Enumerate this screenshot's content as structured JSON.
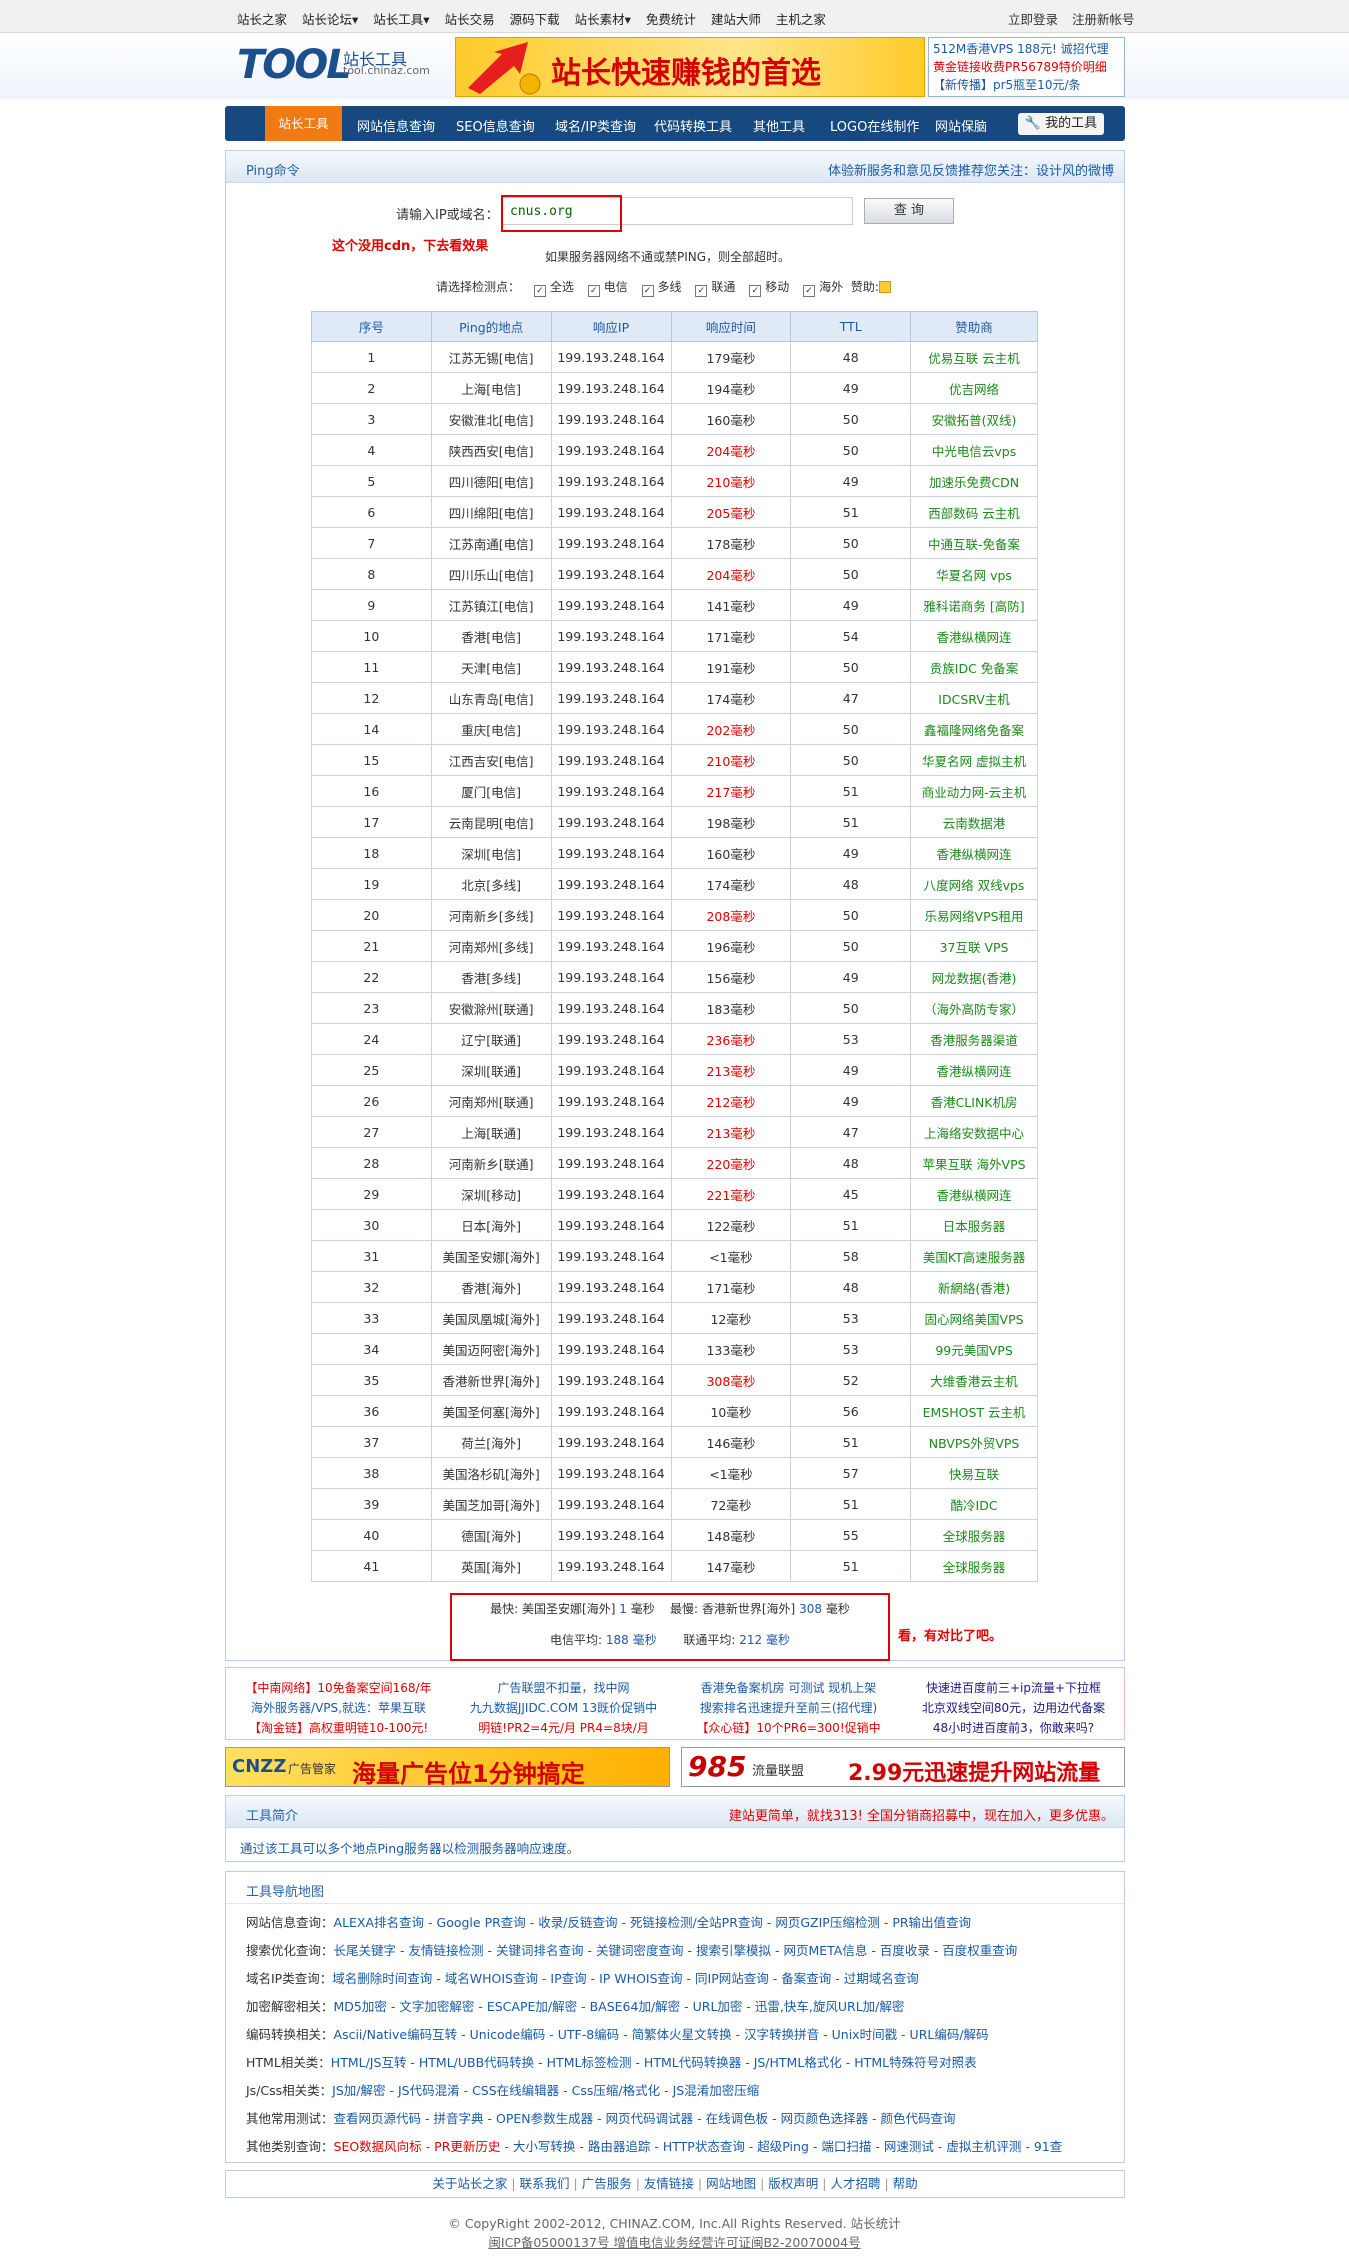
{
  "top_nav": [
    "站长之家",
    "站长论坛▾",
    "站长工具▾",
    "站长交易",
    "源码下载",
    "站长素材▾",
    "免费统计",
    "建站大师",
    "主机之家"
  ],
  "top_right": [
    "立即登录",
    "注册新帐号"
  ],
  "logo": {
    "main": "TOOL",
    "cn": "站长工具",
    "url": "tool.chinaz.com"
  },
  "banner_text": "站长快速赚钱的首选",
  "side_ads": [
    "512M香港VPS 188元! 诚招代理",
    "黄金链接收费PR56789特价明细",
    "【新传播】pr5瓶至10元/条"
  ],
  "menu": {
    "active": "站长工具",
    "items": [
      "网站信息查询",
      "SEO信息查询",
      "域名/IP类查询",
      "代码转换工具",
      "其他工具",
      "LOGO在线制作",
      "网站保脑"
    ],
    "mine": "我的工具"
  },
  "ping": {
    "title": "Ping命令",
    "notice": "体验新服务和意见反馈推荐您关注：设计风的微博",
    "input_label": "请输入IP或域名：",
    "input_value": "cnus.org",
    "query_btn": "查  询",
    "note": "这个没用cdn，下去看效果",
    "tip": "如果服务器网络不通或禁PING，则全部超时。",
    "checks_label": "请选择检测点：",
    "checks": [
      "全选",
      "电信",
      "多线",
      "联通",
      "移动",
      "海外"
    ],
    "sponsor_label": "赞助:"
  },
  "table": {
    "headers": [
      "序号",
      "Ping的地点",
      "响应IP",
      "响应时间",
      "TTL",
      "赞助商"
    ],
    "rows": [
      [
        "1",
        "江苏无锡[电信]",
        "199.193.248.164",
        "179毫秒",
        "48",
        "优易互联  云主机"
      ],
      [
        "2",
        "上海[电信]",
        "199.193.248.164",
        "194毫秒",
        "49",
        "优吉网络"
      ],
      [
        "3",
        "安徽淮北[电信]",
        "199.193.248.164",
        "160毫秒",
        "50",
        "安徽拓普(双线)"
      ],
      [
        "4",
        "陕西西安[电信]",
        "199.193.248.164",
        "204毫秒",
        "50",
        "中光电信云vps"
      ],
      [
        "5",
        "四川德阳[电信]",
        "199.193.248.164",
        "210毫秒",
        "49",
        "加速乐免费CDN"
      ],
      [
        "6",
        "四川绵阳[电信]",
        "199.193.248.164",
        "205毫秒",
        "51",
        "西部数码  云主机"
      ],
      [
        "7",
        "江苏南通[电信]",
        "199.193.248.164",
        "178毫秒",
        "50",
        "中通互联-免备案"
      ],
      [
        "8",
        "四川乐山[电信]",
        "199.193.248.164",
        "204毫秒",
        "50",
        "华夏名网  vps"
      ],
      [
        "9",
        "江苏镇江[电信]",
        "199.193.248.164",
        "141毫秒",
        "49",
        "雅科诺商务 [高防]"
      ],
      [
        "10",
        "香港[电信]",
        "199.193.248.164",
        "171毫秒",
        "54",
        "香港纵横网连"
      ],
      [
        "11",
        "天津[电信]",
        "199.193.248.164",
        "191毫秒",
        "50",
        "贵族IDC 免备案"
      ],
      [
        "12",
        "山东青岛[电信]",
        "199.193.248.164",
        "174毫秒",
        "47",
        "IDCSRV主机"
      ],
      [
        "14",
        "重庆[电信]",
        "199.193.248.164",
        "202毫秒",
        "50",
        "鑫福隆网络免备案"
      ],
      [
        "15",
        "江西吉安[电信]",
        "199.193.248.164",
        "210毫秒",
        "50",
        "华夏名网  虚拟主机"
      ],
      [
        "16",
        "厦门[电信]",
        "199.193.248.164",
        "217毫秒",
        "51",
        "商业动力网-云主机"
      ],
      [
        "17",
        "云南昆明[电信]",
        "199.193.248.164",
        "198毫秒",
        "51",
        "云南数据港"
      ],
      [
        "18",
        "深圳[电信]",
        "199.193.248.164",
        "160毫秒",
        "49",
        "香港纵横网连"
      ],
      [
        "19",
        "北京[多线]",
        "199.193.248.164",
        "174毫秒",
        "48",
        "八度网络 双线vps"
      ],
      [
        "20",
        "河南新乡[多线]",
        "199.193.248.164",
        "208毫秒",
        "50",
        "乐易网络VPS租用"
      ],
      [
        "21",
        "河南郑州[多线]",
        "199.193.248.164",
        "196毫秒",
        "50",
        "37互联  VPS"
      ],
      [
        "22",
        "香港[多线]",
        "199.193.248.164",
        "156毫秒",
        "49",
        "网龙数据(香港)"
      ],
      [
        "23",
        "安徽滁州[联通]",
        "199.193.248.164",
        "183毫秒",
        "50",
        "（海外高防专家）"
      ],
      [
        "24",
        "辽宁[联通]",
        "199.193.248.164",
        "236毫秒",
        "53",
        "香港服务器渠道"
      ],
      [
        "25",
        "深圳[联通]",
        "199.193.248.164",
        "213毫秒",
        "49",
        "香港纵横网连"
      ],
      [
        "26",
        "河南郑州[联通]",
        "199.193.248.164",
        "212毫秒",
        "49",
        "香港CLINK机房"
      ],
      [
        "27",
        "上海[联通]",
        "199.193.248.164",
        "213毫秒",
        "47",
        "上海络安数据中心"
      ],
      [
        "28",
        "河南新乡[联通]",
        "199.193.248.164",
        "220毫秒",
        "48",
        "苹果互联  海外VPS"
      ],
      [
        "29",
        "深圳[移动]",
        "199.193.248.164",
        "221毫秒",
        "45",
        "香港纵横网连"
      ],
      [
        "30",
        "日本[海外]",
        "199.193.248.164",
        "122毫秒",
        "51",
        "日本服务器"
      ],
      [
        "31",
        "美国圣安娜[海外]",
        "199.193.248.164",
        "<1毫秒",
        "58",
        "美国KT高速服务器"
      ],
      [
        "32",
        "香港[海外]",
        "199.193.248.164",
        "171毫秒",
        "48",
        "新網絡(香港)"
      ],
      [
        "33",
        "美国凤凰城[海外]",
        "199.193.248.164",
        "12毫秒",
        "53",
        "固心网络美国VPS"
      ],
      [
        "34",
        "美国迈阿密[海外]",
        "199.193.248.164",
        "133毫秒",
        "53",
        "99元美国VPS"
      ],
      [
        "35",
        "香港新世界[海外]",
        "199.193.248.164",
        "308毫秒",
        "52",
        "大维香港云主机"
      ],
      [
        "36",
        "美国圣何塞[海外]",
        "199.193.248.164",
        "10毫秒",
        "56",
        "EMSHOST  云主机"
      ],
      [
        "37",
        "荷兰[海外]",
        "199.193.248.164",
        "146毫秒",
        "51",
        "NBVPS外贸VPS"
      ],
      [
        "38",
        "美国洛杉矶[海外]",
        "199.193.248.164",
        "<1毫秒",
        "57",
        "快易互联"
      ],
      [
        "39",
        "美国芝加哥[海外]",
        "199.193.248.164",
        "72毫秒",
        "51",
        "酷冷IDC"
      ],
      [
        "40",
        "德国[海外]",
        "199.193.248.164",
        "148毫秒",
        "55",
        "全球服务器"
      ],
      [
        "41",
        "英国[海外]",
        "199.193.248.164",
        "147毫秒",
        "51",
        "全球服务器"
      ]
    ]
  },
  "summary": {
    "fast_label": "最快:",
    "fast_loc": "美国圣安娜[海外]",
    "fast_val": "1",
    "slow_label": "最慢:",
    "slow_loc": "香港新世界[海外]",
    "slow_val": "308",
    "unit": "毫秒",
    "tel_label": "电信平均:",
    "tel_val": "188",
    "uni_label": "联通平均:",
    "uni_val": "212"
  },
  "summary_note": "看，有对比了吧。",
  "text_ads": [
    [
      "【中南网络】10免备案空间168/年",
      "海外服务器/VPS,就选：苹果互联",
      "【淘金链】高权重明链10-100元!"
    ],
    [
      "广告联盟不扣量，找中网",
      "九九数据JJIDC.COM 13既价促销中",
      "明链!PR2=4元/月 PR4=8块/月"
    ],
    [
      "香港免备案机房 可测试 现机上架",
      "搜索排名迅速提升至前三(招代理)",
      "【众心链】10个PR6=300!促销中"
    ],
    [
      "快速进百度前三+ip流量+下拉框",
      "北京双线空间80元，边用边代备案",
      "48小时进百度前3，你敢来吗?"
    ]
  ],
  "cnzz_ad": {
    "brand": "CNZZ",
    "sub": "广告管家",
    "text": "海量广告位1分钟搞定"
  },
  "ad985": {
    "brand": "985",
    "sub": "流量联盟",
    "text": "2.99元迅速提升网站流量"
  },
  "intro": {
    "title": "工具简介",
    "right": "建站更简单，就找313! 全国分销商招募中，现在加入，更多优惠。",
    "desc": "通过该工具可以多个地点Ping服务器以检测服务器响应速度。"
  },
  "nav_map": {
    "title": "工具导航地图",
    "rows": [
      {
        "label": "网站信息查询：",
        "links": [
          "ALEXA排名查询",
          "Google PR查询",
          "收录/反链查询",
          "死链接检测/全站PR查询",
          "网页GZIP压缩检测",
          "PR输出值查询"
        ]
      },
      {
        "label": "搜索优化查询：",
        "links": [
          "长尾关键字",
          "友情链接检测",
          "关键词排名查询",
          "关键词密度查询",
          "搜索引擎模拟",
          "网页META信息",
          "百度收录",
          "百度权重查询"
        ]
      },
      {
        "label": "域名IP类查询：",
        "links": [
          "域名删除时间查询",
          "域名WHOIS查询",
          "IP查询",
          "IP WHOIS查询",
          "同IP网站查询",
          "备案查询",
          "过期域名查询"
        ]
      },
      {
        "label": "加密解密相关：",
        "links": [
          "MD5加密",
          "文字加密解密",
          "ESCAPE加/解密",
          "BASE64加/解密",
          "URL加密",
          "迅雷,快车,旋风URL加/解密"
        ]
      },
      {
        "label": "编码转换相关：",
        "links": [
          "Ascii/Native编码互转",
          "Unicode编码",
          "UTF-8编码",
          "简繁体火星文转换",
          "汉字转换拼音",
          "Unix时间戳",
          "URL编码/解码"
        ]
      },
      {
        "label": "HTML相关类：",
        "links": [
          "HTML/JS互转",
          "HTML/UBB代码转换",
          "HTML标签检测",
          "HTML代码转换器",
          "JS/HTML格式化",
          "HTML特殊符号对照表"
        ]
      },
      {
        "label": "Js/Css相关类：",
        "links": [
          "JS加/解密",
          "JS代码混淆",
          "CSS在线编辑器",
          "Css压缩/格式化",
          "JS混淆加密压缩"
        ]
      },
      {
        "label": "其他常用测试：",
        "links": [
          "查看网页源代码",
          "拼音字典",
          "OPEN参数生成器",
          "网页代码调试器",
          "在线调色板",
          "网页颜色选择器",
          "颜色代码查询"
        ]
      },
      {
        "label": "其他类别查询：",
        "links": [
          "SEO数据风向标",
          "PR更新历史",
          "大小写转换",
          "路由器追踪",
          "HTTP状态查询",
          "超级Ping",
          "端口扫描",
          "网速测试",
          "虚拟主机评测",
          "91查"
        ]
      }
    ]
  },
  "footer_links": [
    "关于站长之家",
    "联系我们",
    "广告服务",
    "友情链接",
    "网站地图",
    "版权声明",
    "人才招聘",
    "帮助"
  ],
  "copyright": "© CopyRight 2002-2012, CHINAZ.COM, Inc.All Rights Reserved. 站长统计",
  "icp": "闽ICP备05000137号  增值电信业务经营许可证闽B2-20070004号"
}
